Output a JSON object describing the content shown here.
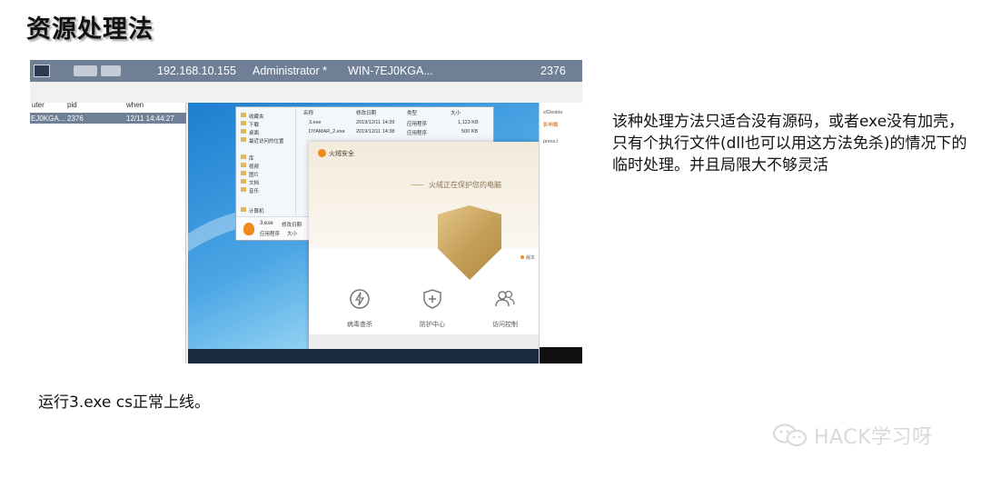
{
  "slide": {
    "title": "资源处理法",
    "description": "该种处理方法只适合没有源码，或者exe没有加壳，只有个执行文件(dll也可以用这方法免杀)的情况下的临时处理。并且局限大不够灵活",
    "caption": "运行3.exe cs正常上线。",
    "watermark": "HACK学习呀"
  },
  "cs_bar": {
    "ip": "192.168.10.155",
    "user": "Administrator *",
    "computer": "WIN-7EJ0KGA...",
    "pid": "2376"
  },
  "cs_table": {
    "columns": [
      "uter",
      "pid",
      "when"
    ],
    "row": {
      "computer": "EJ0KGA...",
      "pid": "2376",
      "when": "12/11 14:44:27"
    }
  },
  "explorer": {
    "nav": [
      "收藏夹",
      "下载",
      "桌面",
      "最近访问的位置",
      "库",
      "视频",
      "图片",
      "文档",
      "音乐",
      "计算机"
    ],
    "columns": [
      "名称",
      "修改日期",
      "类型",
      "大小"
    ],
    "files": [
      {
        "name": "3.exe",
        "date": "2019/12/11 14:39",
        "type": "应用程序",
        "size": "1,123 KB"
      },
      {
        "name": "DYAMAR_2.exe",
        "date": "2019/12/11 14:38",
        "type": "应用程序",
        "size": "500 KB"
      }
    ],
    "footer": {
      "name": "3.exe",
      "date_label": "修改日期",
      "type": "应用程序",
      "size_label": "大小"
    }
  },
  "antivirus": {
    "brand": "火绒安全",
    "status": "火绒正在保护您的电脑",
    "note": "版本",
    "items": [
      "病毒查杀",
      "防护中心",
      "访问控制"
    ],
    "accent": "#f08a1e"
  },
  "right_strip": [
    "s\\Deskto",
    "影响载",
    "press.I"
  ]
}
